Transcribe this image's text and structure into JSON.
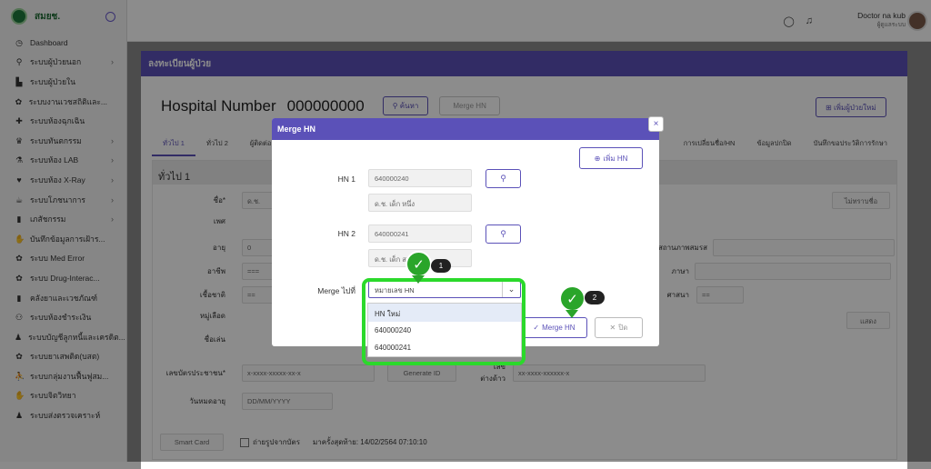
{
  "sidebar": {
    "brand": "สมยช.",
    "items": [
      {
        "label": "Dashboard",
        "icon": "◷",
        "chev": ""
      },
      {
        "label": "ระบบผู้ป่วยนอก",
        "icon": "⚲",
        "chev": "›"
      },
      {
        "label": "ระบบผู้ป่วยใน",
        "icon": "▙",
        "chev": ""
      },
      {
        "label": "ระบบงานเวชสถิติและ...",
        "icon": "✿",
        "chev": ""
      },
      {
        "label": "ระบบห้องฉุกเฉิน",
        "icon": "✚",
        "chev": ""
      },
      {
        "label": "ระบบทันตกรรม",
        "icon": "♛",
        "chev": "›"
      },
      {
        "label": "ระบบห้อง LAB",
        "icon": "⚗",
        "chev": "›"
      },
      {
        "label": "ระบบห้อง X-Ray",
        "icon": "♥",
        "chev": "›"
      },
      {
        "label": "ระบบโภชนาการ",
        "icon": "☕",
        "chev": "›"
      },
      {
        "label": "เภสัชกรรม",
        "icon": "▮",
        "chev": "›"
      },
      {
        "label": "บันทึกข้อมูลการเฝ้าร...",
        "icon": "✋",
        "chev": ""
      },
      {
        "label": "ระบบ Med Error",
        "icon": "✿",
        "chev": ""
      },
      {
        "label": "ระบบ Drug-Interac...",
        "icon": "✿",
        "chev": ""
      },
      {
        "label": "คลังยาและเวชภัณฑ์",
        "icon": "▮",
        "chev": ""
      },
      {
        "label": "ระบบห้องชำระเงิน",
        "icon": "⚇",
        "chev": ""
      },
      {
        "label": "ระบบบัญชีลูกหนี้และเครดิต...",
        "icon": "♟",
        "chev": ""
      },
      {
        "label": "ระบบยาเสพติด(บสต)",
        "icon": "✿",
        "chev": ""
      },
      {
        "label": "ระบบกลุ่มงานฟื้นฟูสม...",
        "icon": "⛹",
        "chev": ""
      },
      {
        "label": "ระบบจิตวิทยา",
        "icon": "✋",
        "chev": ""
      },
      {
        "label": "ระบบส่งตรวจเคราะห์",
        "icon": "♟",
        "chev": ""
      }
    ]
  },
  "topbar": {
    "user_name": "Doctor na kub",
    "user_role": "ผู้ดูแลระบบ"
  },
  "main": {
    "banner": "ลงทะเบียนผู้ป่วย",
    "hn_label": "Hospital Number",
    "hn_value": "000000000",
    "search_btn": "ค้นหา",
    "merge_btn": "Merge HN",
    "add_patient_btn": "เพิ่มผู้ป่วยใหม่",
    "tabs": [
      "ทั่วไป 1",
      "ทั่วไป 2",
      "ผู้ติดต่อ",
      "การเปลี่ยนชื่อ/HN",
      "ข้อมูลปกปิด",
      "บันทึกขอประวัติการรักษา"
    ],
    "panel_title": "ทั่วไป 1",
    "form": {
      "name_label": "ชื่อ*",
      "prefix_value": "ด.ช.",
      "verify_btn": "ไม่ทราบชื่อ",
      "sex_label": "เพศ",
      "age_label": "อายุ",
      "age_value": "0",
      "marital_label": "สถานภาพสมรส",
      "job_label": "อาชีพ",
      "job_value": "===",
      "lang_label": "ภาษา",
      "nation_label": "เชื้อชาติ",
      "nation_value": "==",
      "religion_label": "ศาสนา",
      "religion_value": "==",
      "blood_label": "หมู่เลือด",
      "nickname_label": "ชื่อเล่น",
      "id_label": "เลขบัตรประชาชน*",
      "id_placeholder": "x-xxxx-xxxxx-xx-x",
      "generate_btn": "Generate ID",
      "foreign_label": "เลขต่างด้าว",
      "foreign_placeholder": "xx-xxxx-xxxxxx-x",
      "expire_label": "วันหมดอายุ",
      "expire_placeholder": "DD/MM/YYYY",
      "smartcard_btn": "Smart Card",
      "photo_label": "ถ่ายรูปจากบัตร",
      "last_visit": "มาครั้งสุดท้าย: 14/02/2564 07:10:10",
      "extra_btn": "แสดง"
    }
  },
  "modal": {
    "title": "Merge HN",
    "close": "×",
    "add_hn_btn": "เพิ่ม HN",
    "hn1_label": "HN 1",
    "hn1_value": "640000240",
    "hn1_name": "ด.ช. เด็ก หนึ่ง",
    "hn2_label": "HN 2",
    "hn2_value": "640000241",
    "hn2_name": "ด.ช. เด็ก สอ",
    "merge_to_label": "Merge ไปที่",
    "select_value": "หมายเลข HN",
    "options": [
      "HN ใหม่",
      "640000240",
      "640000241"
    ],
    "merge_btn": "Merge HN",
    "cancel_btn": "ปิด",
    "step1": "1",
    "step2": "2"
  }
}
